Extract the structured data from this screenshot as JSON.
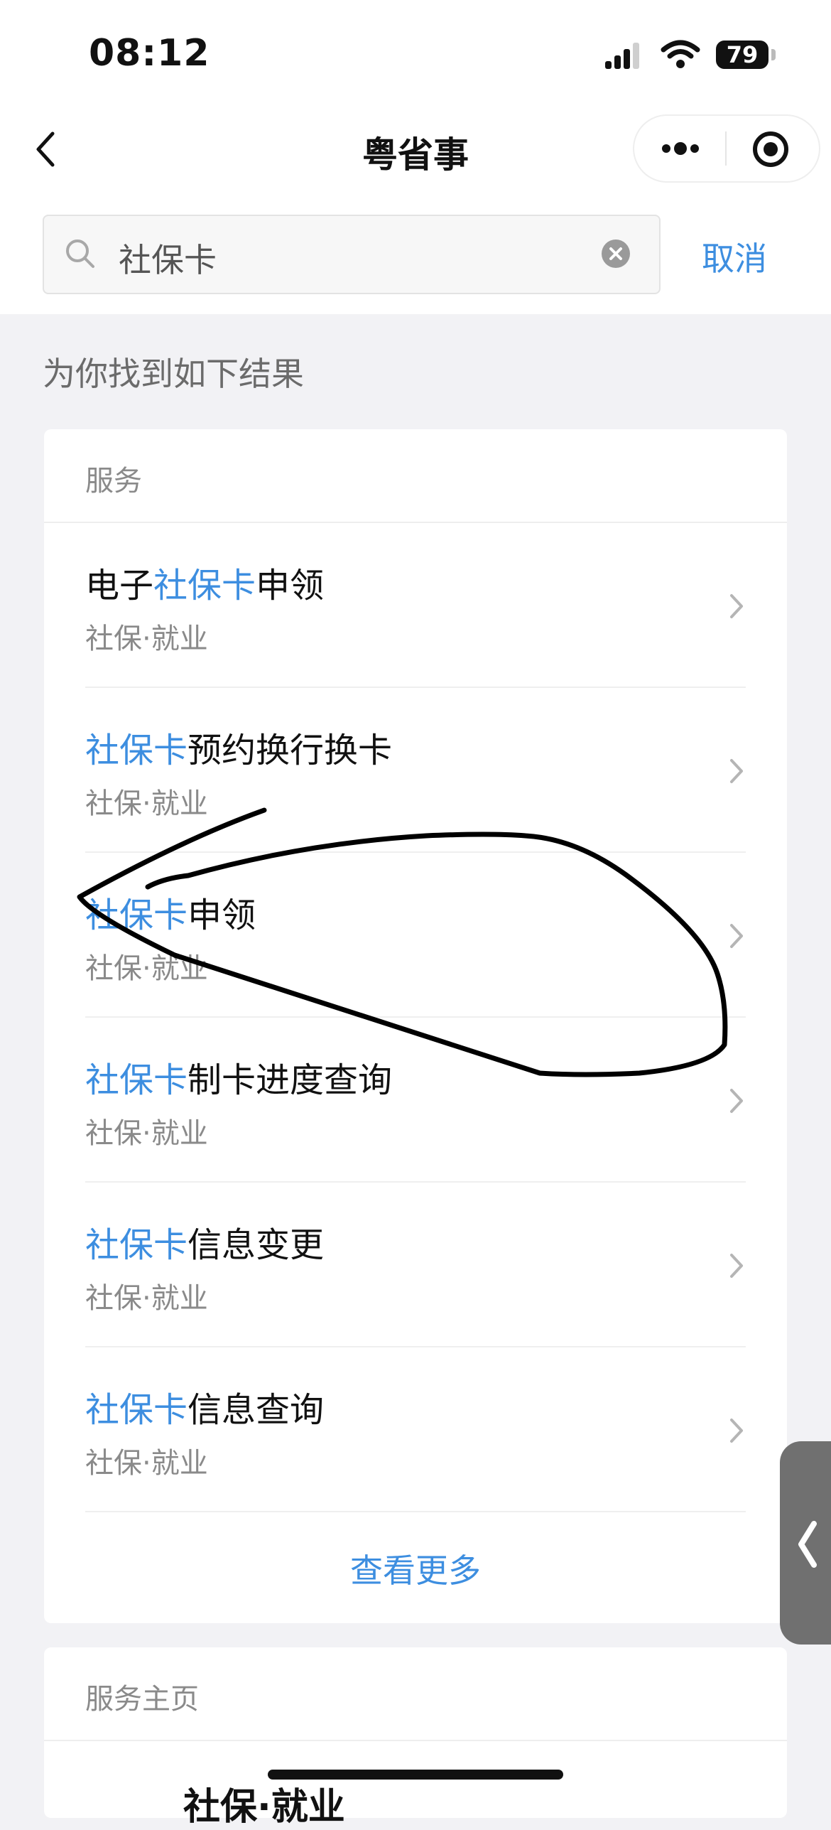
{
  "status_bar": {
    "time": "08:12",
    "battery": "79"
  },
  "nav": {
    "title": "粤省事"
  },
  "search": {
    "query": "社保卡",
    "cancel_label": "取消"
  },
  "results_hint": "为你找到如下结果",
  "services": {
    "section_title": "服务",
    "items": [
      {
        "pre": "电子",
        "hl": "社保卡",
        "post": "申领",
        "sub": "社保·就业"
      },
      {
        "pre": "",
        "hl": "社保卡",
        "post": "预约换行换卡",
        "sub": "社保·就业"
      },
      {
        "pre": "",
        "hl": "社保卡",
        "post": "申领",
        "sub": "社保·就业"
      },
      {
        "pre": "",
        "hl": "社保卡",
        "post": "制卡进度查询",
        "sub": "社保·就业"
      },
      {
        "pre": "",
        "hl": "社保卡",
        "post": "信息变更",
        "sub": "社保·就业"
      },
      {
        "pre": "",
        "hl": "社保卡",
        "post": "信息查询",
        "sub": "社保·就业"
      }
    ],
    "more_label": "查看更多"
  },
  "service_home": {
    "section_title": "服务主页",
    "peek_text": "社保·就业"
  },
  "colors": {
    "accent": "#3d8ee0",
    "background": "#f2f2f5",
    "annotation": "#000000"
  },
  "icons": [
    "back-chevron-icon",
    "more-dots-icon",
    "target-circle-icon",
    "search-icon",
    "clear-icon",
    "chevron-right-icon",
    "collapse-arrow-icon"
  ]
}
